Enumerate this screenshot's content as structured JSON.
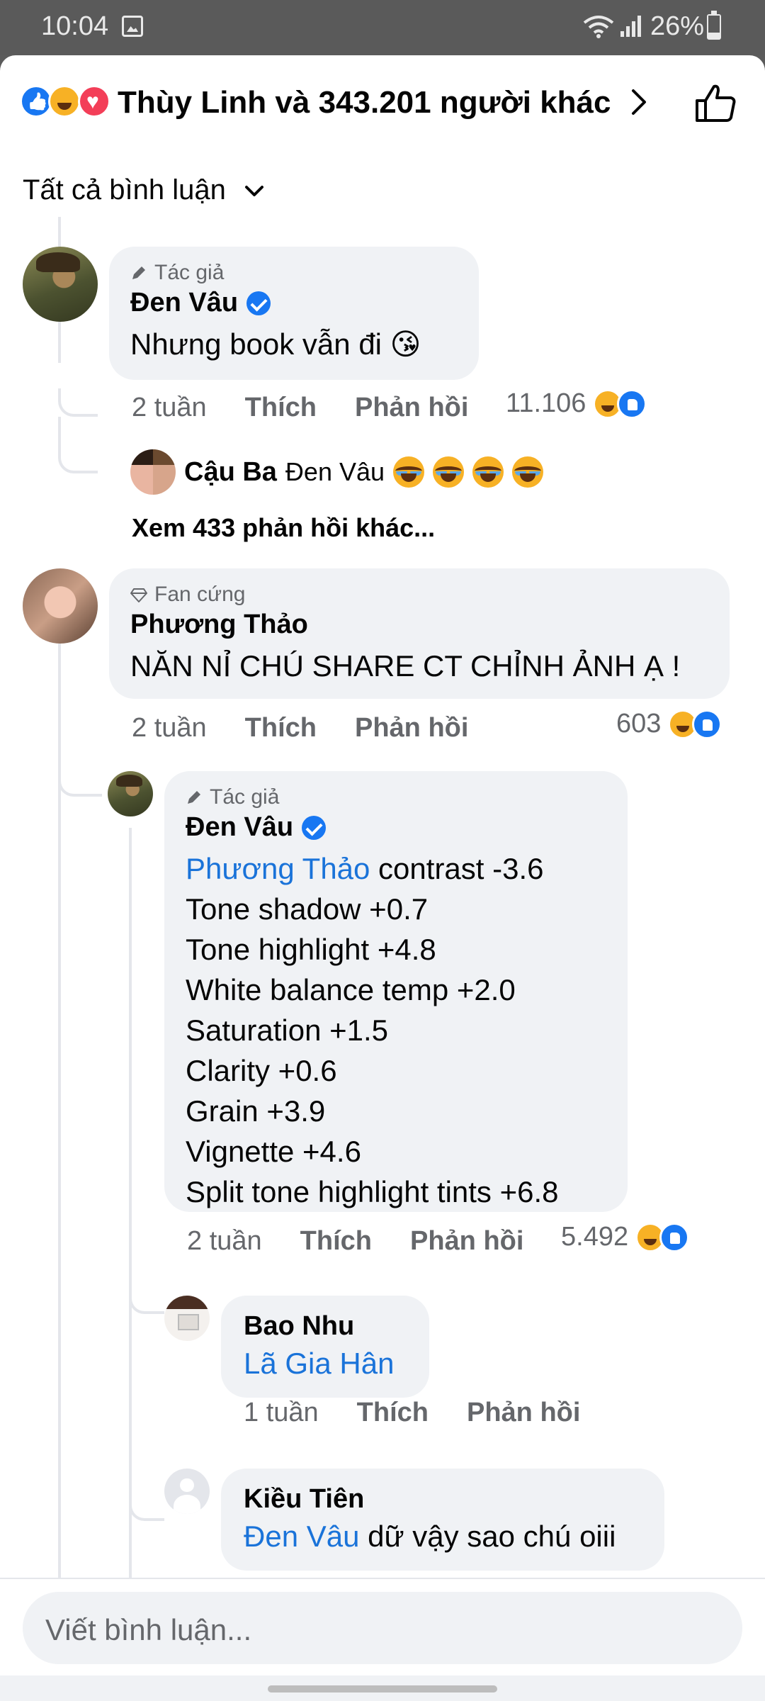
{
  "status_bar": {
    "time": "10:04",
    "battery": "26%"
  },
  "header": {
    "reactions": [
      "like-icon",
      "haha-icon",
      "love-icon"
    ],
    "summary": "Thùy Linh và 343.201 người khác"
  },
  "filter": {
    "label": "Tất cả bình luận"
  },
  "comments": [
    {
      "badge": "Tác giả",
      "name": "Đen Vâu",
      "verified": true,
      "text": "Nhưng book vẫn đi 😘",
      "time": "2 tuần",
      "like": "Thích",
      "reply": "Phản hồi",
      "reaction_count": "11.106",
      "reply_preview": {
        "name": "Cậu Ba",
        "mention": "Đen Vâu",
        "emojis": [
          "face-with-tears-of-joy-icon",
          "face-with-tears-of-joy-icon",
          "face-with-tears-of-joy-icon",
          "face-with-tears-of-joy-icon"
        ]
      },
      "more_replies": "Xem 433 phản hồi khác..."
    },
    {
      "badge": "Fan cứng",
      "name": "Phương Thảo",
      "text": "NĂN NỈ CHÚ SHARE CT CHỈNH ẢNH Ạ !",
      "time": "2 tuần",
      "like": "Thích",
      "reply": "Phản hồi",
      "reaction_count": "603"
    }
  ],
  "nested_reply": {
    "badge": "Tác giả",
    "name": "Đen Vâu",
    "verified": true,
    "mention": "Phương Thảo",
    "first_line_rest": " contrast -3.6",
    "lines": [
      "Tone shadow +0.7",
      "Tone highlight +4.8",
      "White balance temp +2.0",
      "Saturation +1.5",
      "Clarity +0.6",
      "Grain +3.9",
      "Vignette +4.6",
      "Split tone highlight tints +6.8"
    ],
    "time": "2 tuần",
    "like": "Thích",
    "reply": "Phản hồi",
    "reaction_count": "5.492"
  },
  "sub_replies": [
    {
      "name": "Bao Nhu",
      "mention": "Lã Gia Hân",
      "rest": "",
      "time": "1 tuần",
      "like": "Thích",
      "reply": "Phản hồi"
    },
    {
      "name": "Kiều Tiên",
      "mention": "Đen Vâu",
      "rest": " dữ vậy sao chú oiii"
    }
  ],
  "composer": {
    "placeholder": "Viết bình luận..."
  }
}
